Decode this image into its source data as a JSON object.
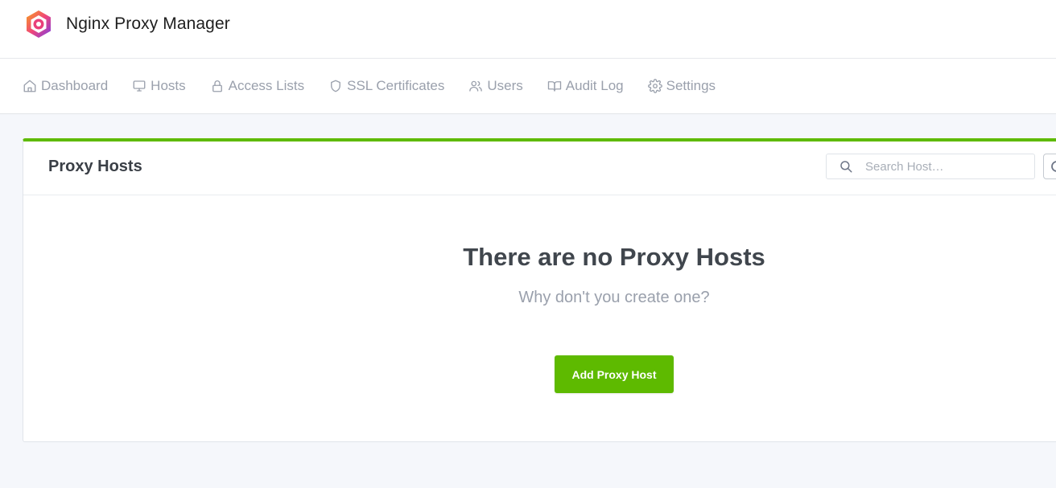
{
  "app": {
    "title": "Nginx Proxy Manager",
    "logo_icon": "hexagon-logo-icon"
  },
  "nav": {
    "items": [
      {
        "label": "Dashboard",
        "icon": "home-icon"
      },
      {
        "label": "Hosts",
        "icon": "monitor-icon"
      },
      {
        "label": "Access Lists",
        "icon": "lock-icon"
      },
      {
        "label": "SSL Certificates",
        "icon": "shield-icon"
      },
      {
        "label": "Users",
        "icon": "users-icon"
      },
      {
        "label": "Audit Log",
        "icon": "book-icon"
      },
      {
        "label": "Settings",
        "icon": "gear-icon"
      }
    ]
  },
  "card": {
    "title": "Proxy Hosts",
    "search": {
      "placeholder": "Search Host…",
      "value": ""
    },
    "empty": {
      "title": "There are no Proxy Hosts",
      "subtitle": "Why don't you create one?"
    },
    "add_button_label": "Add Proxy Host"
  },
  "colors": {
    "accent": "#5eba00",
    "nav_text": "#9aa0ac",
    "page_background": "#f5f7fb"
  }
}
